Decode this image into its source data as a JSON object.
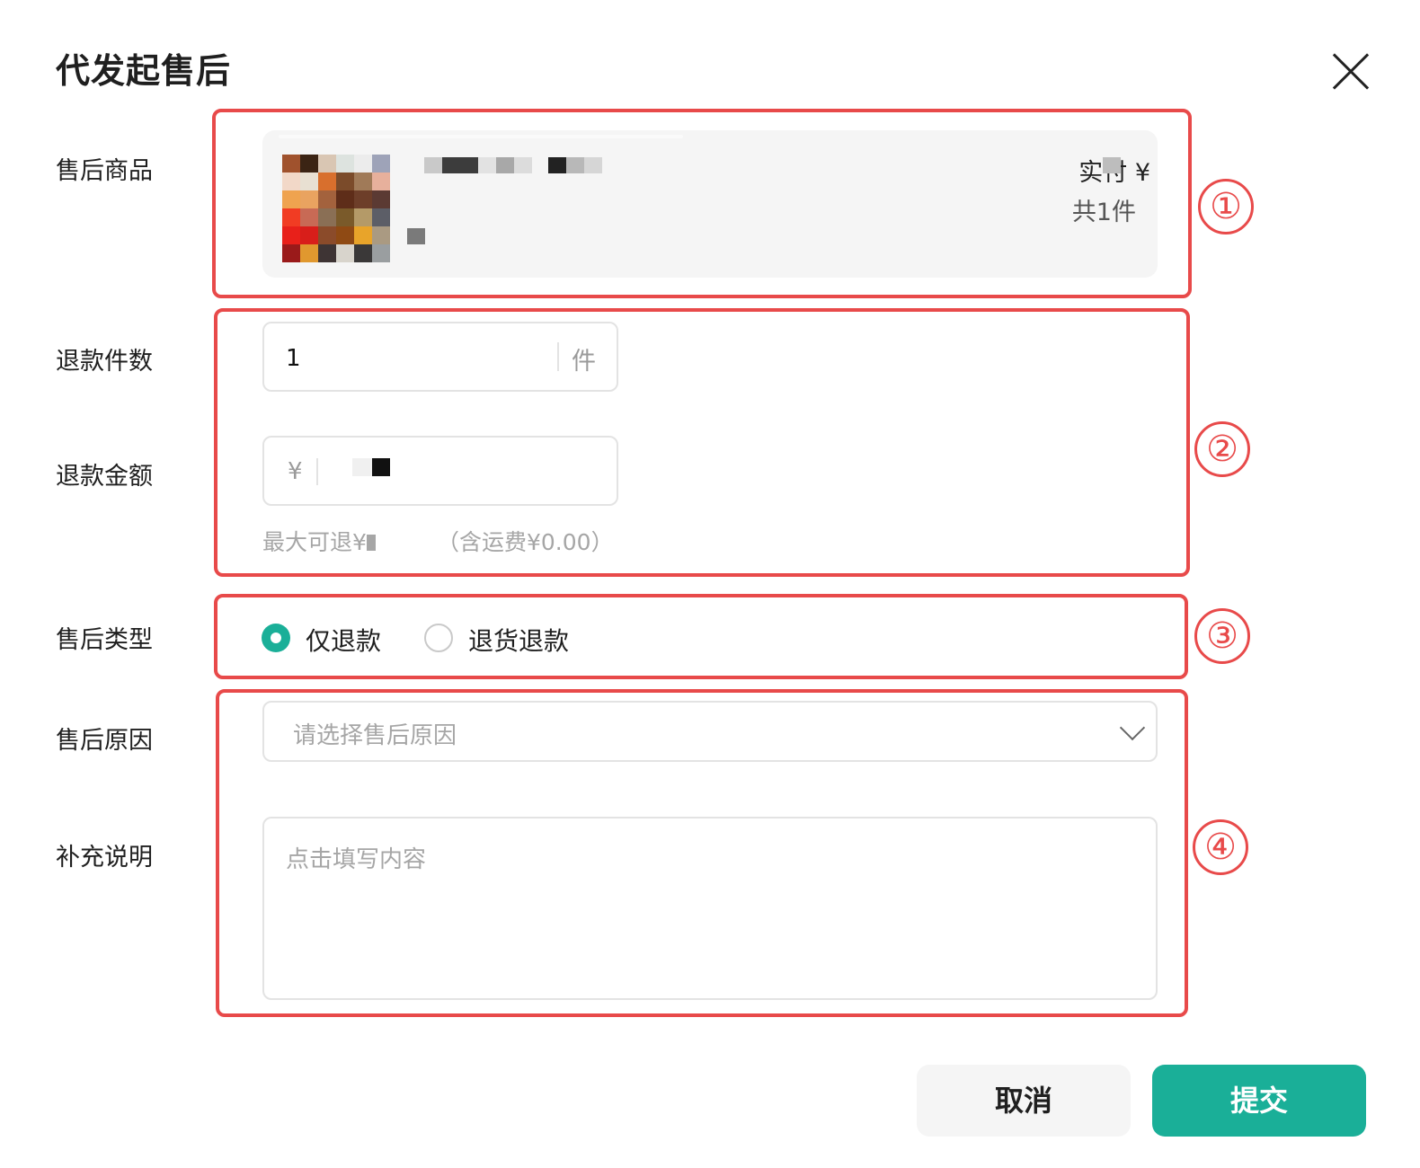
{
  "dialog": {
    "title": "代发起售后"
  },
  "labels": {
    "product": "售后商品",
    "refund_qty": "退款件数",
    "refund_amount": "退款金额",
    "type": "售后类型",
    "reason": "售后原因",
    "note": "补充说明"
  },
  "product": {
    "paid_label": "实付 ¥",
    "count": "共1件"
  },
  "refund_qty": {
    "value": "1",
    "unit": "件"
  },
  "refund_amount": {
    "currency": "¥",
    "max_hint": "最大可退¥",
    "shipping_hint": "（含运费¥0.00）"
  },
  "after_sale_type": {
    "options": [
      "仅退款",
      "退货退款"
    ],
    "selected": "仅退款"
  },
  "reason": {
    "placeholder": "请选择售后原因"
  },
  "note": {
    "placeholder": "点击填写内容"
  },
  "buttons": {
    "cancel": "取消",
    "submit": "提交"
  },
  "annotations": [
    "①",
    "②",
    "③",
    "④"
  ],
  "colors": {
    "accent": "#1aaf98",
    "annotation": "#e84a4a"
  }
}
